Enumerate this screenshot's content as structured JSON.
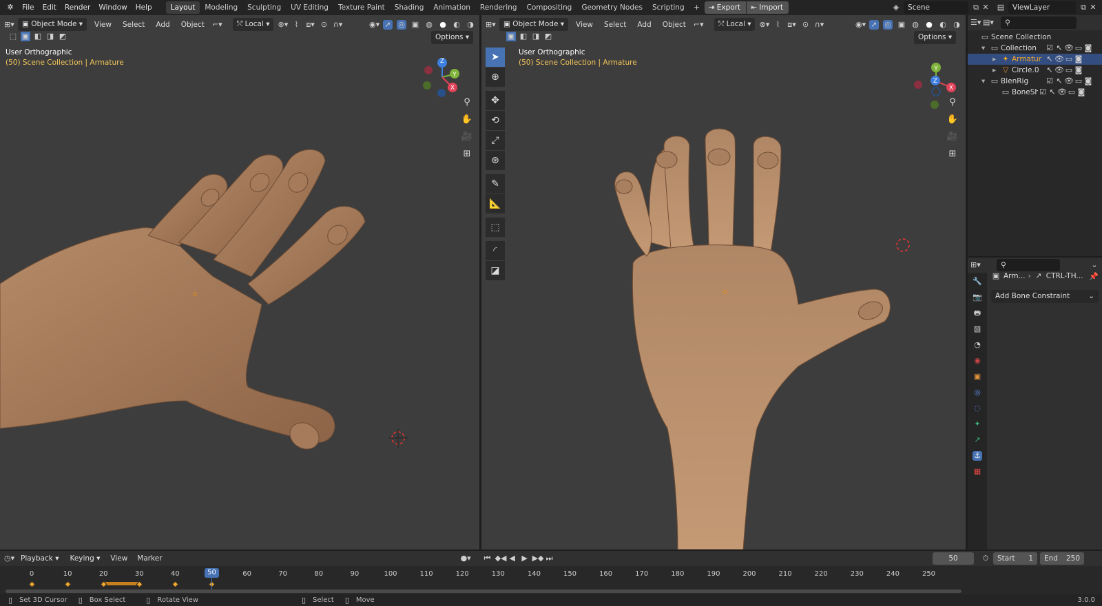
{
  "topbar": {
    "menus": [
      "File",
      "Edit",
      "Render",
      "Window",
      "Help"
    ],
    "workspaces": [
      "Layout",
      "Modeling",
      "Sculpting",
      "UV Editing",
      "Texture Paint",
      "Shading",
      "Animation",
      "Rendering",
      "Compositing",
      "Geometry Nodes",
      "Scripting"
    ],
    "active_workspace": "Layout",
    "export_label": "Export",
    "import_label": "Import",
    "scene": "Scene",
    "view_layer": "ViewLayer"
  },
  "viewport_left": {
    "mode": "Object Mode",
    "menus": [
      "View",
      "Select",
      "Add",
      "Object"
    ],
    "orientation": "Local",
    "options": "Options",
    "title": "User Orthographic",
    "subtitle": "(50) Scene Collection | Armature"
  },
  "viewport_right": {
    "mode": "Object Mode",
    "menus": [
      "View",
      "Select",
      "Add",
      "Object"
    ],
    "orientation": "Local",
    "options": "Options",
    "title": "User Orthographic",
    "subtitle": "(50) Scene Collection | Armature"
  },
  "gizmo": {
    "x": "X",
    "y": "Y",
    "z": "Z"
  },
  "outliner": {
    "rows": [
      "Scene Collection",
      "Collection",
      "Armatur",
      "Circle.0",
      "BlenRig",
      "BoneSha"
    ],
    "selected": "Armatur"
  },
  "properties": {
    "breadcrumb_a": "Arm...",
    "breadcrumb_b": "CTRL-TH...",
    "add_constraint": "Add Bone Constraint"
  },
  "timeline": {
    "menus": [
      "Playback",
      "Keying",
      "View",
      "Marker"
    ],
    "current_frame": "50",
    "start_label": "Start",
    "start": "1",
    "end_label": "End",
    "end": "250",
    "ticks": [
      "0",
      "10",
      "20",
      "30",
      "40",
      "50",
      "60",
      "70",
      "80",
      "90",
      "100",
      "110",
      "120",
      "130",
      "140",
      "150",
      "160",
      "170",
      "180",
      "190",
      "200",
      "210",
      "220",
      "230",
      "240",
      "250"
    ]
  },
  "statusbar": {
    "items": [
      "Set 3D Cursor",
      "Box Select",
      "Rotate View",
      "Select",
      "Move"
    ],
    "version": "3.0.0"
  },
  "colors": {
    "accent": "#4772b3",
    "selected_text": "#f5a623",
    "keyframe": "#f0a830",
    "header_yellow": "#f5c85a"
  }
}
